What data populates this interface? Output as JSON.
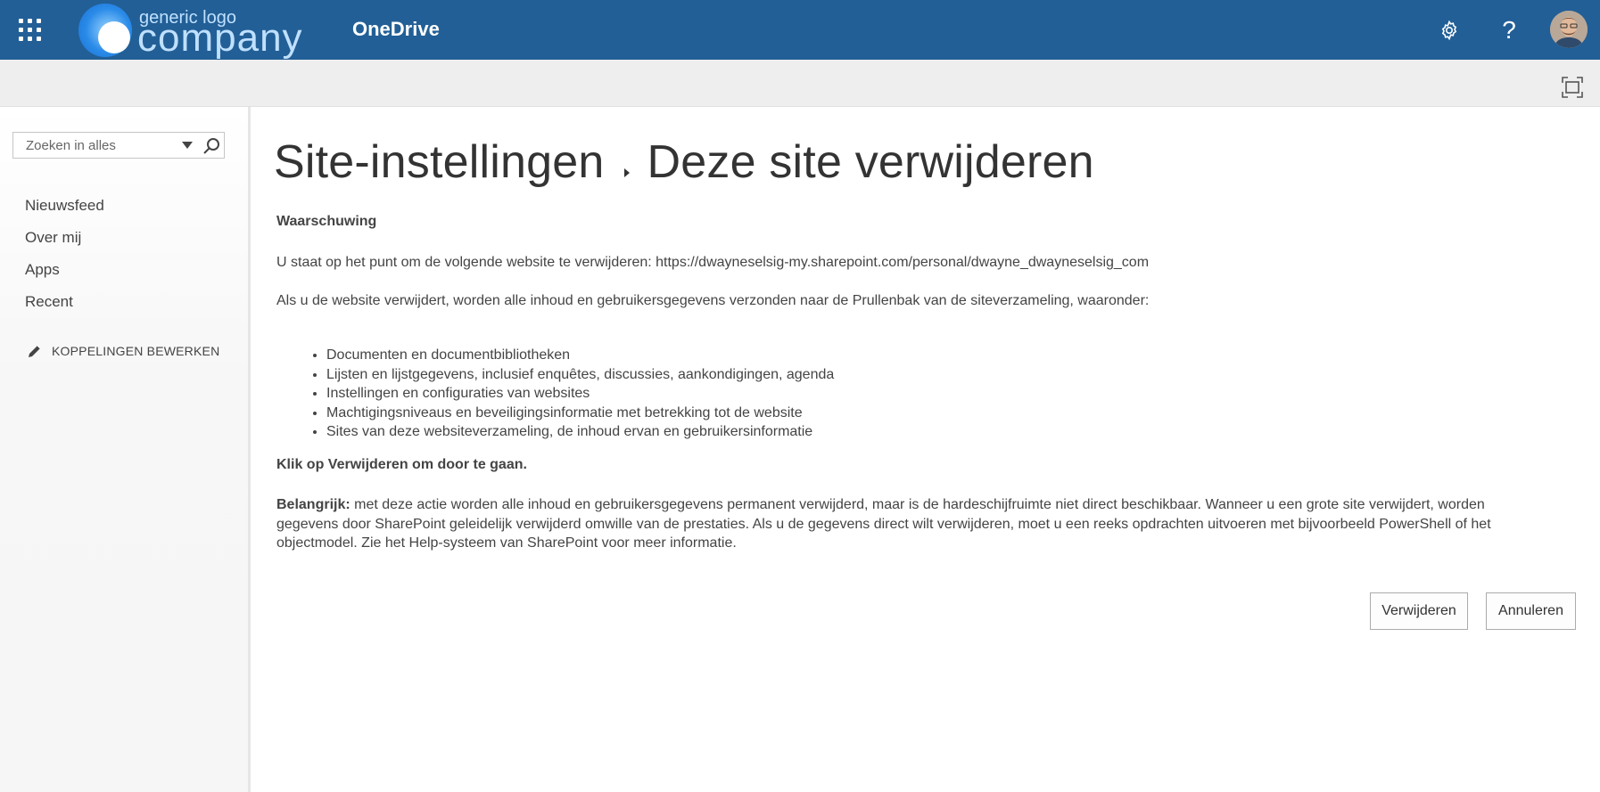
{
  "suite_bar": {
    "logo": {
      "small_text": "generic logo",
      "big_text": "company"
    },
    "app_title": "OneDrive",
    "icons": [
      "app-launcher-icon",
      "gear-icon",
      "help-icon",
      "avatar"
    ],
    "help_glyph": "?",
    "bg_color": "#225f96"
  },
  "search": {
    "placeholder": "Zoeken in alles"
  },
  "left_nav": {
    "items": [
      {
        "label": "Nieuwsfeed"
      },
      {
        "label": "Over mij"
      },
      {
        "label": "Apps"
      },
      {
        "label": "Recent"
      }
    ],
    "edit_links": "KOPPELINGEN BEWERKEN"
  },
  "page": {
    "breadcrumb_parent": "Site-instellingen",
    "breadcrumb_current": "Deze site verwijderen",
    "warning_heading": "Waarschuwing",
    "url_line": "U staat op het punt om de volgende website te verwijderen: https://dwayneselsig-my.sharepoint.com/personal/dwayne_dwayneselsig_com",
    "intro_line": "Als u de website verwijdert, worden alle inhoud en gebruikersgegevens verzonden naar de Prullenbak van de siteverzameling, waaronder:",
    "bullets": [
      "Documenten en documentbibliotheken",
      "Lijsten en lijstgegevens, inclusief enquêtes, discussies, aankondigingen, agenda",
      "Instellingen en configuraties van websites",
      "Machtigingsniveaus en beveiligingsinformatie met betrekking tot de website",
      "Sites van deze websiteverzameling, de inhoud ervan en gebruikersinformatie"
    ],
    "continue_line": "Klik op Verwijderen om door te gaan.",
    "important_label": "Belangrijk:",
    "important_text": "met deze actie worden alle inhoud en gebruikersgegevens permanent verwijderd, maar is de hardeschijfruimte niet direct beschikbaar. Wanneer u een grote site verwijdert, worden gegevens door SharePoint geleidelijk verwijderd omwille van de prestaties. Als u de gegevens direct wilt verwijderen, moet u een reeks opdrachten uitvoeren met bijvoorbeeld PowerShell of het objectmodel. Zie het Help-systeem van SharePoint voor meer informatie."
  },
  "buttons": {
    "delete": "Verwijderen",
    "cancel": "Annuleren"
  }
}
